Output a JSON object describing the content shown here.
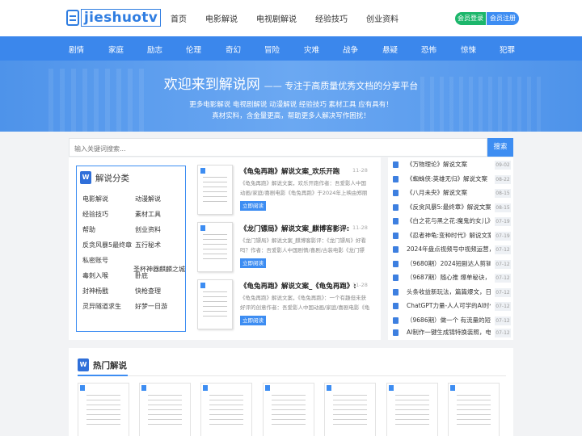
{
  "header": {
    "logo_text": "jieshuotv",
    "nav": [
      "首页",
      "电影解说",
      "电视剧解说",
      "经验技巧",
      "创业资料"
    ],
    "login_label": "会员登录",
    "register_label": "会员注册"
  },
  "categories": [
    "剧情",
    "家庭",
    "励志",
    "伦理",
    "奇幻",
    "冒险",
    "灾难",
    "战争",
    "悬疑",
    "恐怖",
    "惊悚",
    "犯罪"
  ],
  "banner": {
    "title_big": "欢迎来到解说网",
    "title_small": "—— 专注于高质量优秀文档的分享平台",
    "line1": "更多电影解说 电视剧解说 动漫解说 经验技巧 素材工具 应有具有！",
    "line2": "真材实料，含金量更高，帮助更多人解决写作困扰！"
  },
  "search": {
    "placeholder": "输入关键词搜索...",
    "button_label": "搜索"
  },
  "category_box": {
    "icon_letter": "W",
    "title": "解说分类",
    "items": [
      "电影解说",
      "动漫解说",
      "经验技巧",
      "素材工具",
      "帮助",
      "创业资料",
      "反贪风暴5最终章",
      "五行秘术",
      "私密账号",
      "圣杯神器麒麟之城",
      "毒刺入喉",
      "卧底",
      "封神杨戬",
      "快枪查理",
      "灵异隧道求生",
      "好梦一日游"
    ]
  },
  "cards": [
    {
      "title": "《龟兔再跑》解说文案_欢乐开跑",
      "date": "11-28",
      "desc": "《龟兔再跑》解说文案，欢乐开跑作者：吾爱影人中国动画/家庭/喜剧电影《龟兔再跑》于2024年上映由郑丽等",
      "button": "立即阅读"
    },
    {
      "title": "《龙门镖局》解说文案_麒博客影评:",
      "date": "11-28",
      "desc": "《龙门镖局》解说文案_麒博客影评：《龙门镖局》好看吗？作者：吾爱影人中国剧情/喜剧/古装电影《龙门镖",
      "button": "立即阅读"
    },
    {
      "title": "《龟兔再跑》解说文案_《龟兔再跑》:",
      "date": "11-28",
      "desc": "《龟兔再跑》解说文案，《龟兔再跑》：一个有趣但未获好评的创意作者：吾爱影人中国动画/家庭/喜剧电影《龟",
      "button": "立即阅读"
    }
  ],
  "latest_list": [
    {
      "title": "《万物理论》解说文案",
      "date": "09-02"
    },
    {
      "title": "《蜘蛛侠:英雄无归》解说文案",
      "date": "08-22"
    },
    {
      "title": "《八月未央》解说文案",
      "date": "08-15"
    },
    {
      "title": "《反贪风暴5:最终章》解说文案",
      "date": "08-15"
    },
    {
      "title": "《白之花与黑之花:魔鬼的女儿》",
      "date": "07-19"
    },
    {
      "title": "《忍者神龟:变种时代》解说文案",
      "date": "07-19"
    },
    {
      "title": "2024年盘点视频号中视频运营，",
      "date": "07-12"
    },
    {
      "title": "（9680期）2024短剧达人剪辑特",
      "date": "07-12"
    },
    {
      "title": "（9687期）随心推 爆单秘诀，短",
      "date": "07-12"
    },
    {
      "title": "头条收益新玩法，篇篇爆文，日",
      "date": "07-12"
    },
    {
      "title": "ChatGPT力量-人人可学的AI时代",
      "date": "07-12"
    },
    {
      "title": "（9686期）做一个 有流量的短视",
      "date": "07-12"
    },
    {
      "title": "AI制作一键生成锦特换装照，电",
      "date": "07-12"
    }
  ],
  "hot": {
    "icon_letter": "W",
    "title": "热门解说"
  },
  "colors": {
    "primary": "#3d8df2",
    "category_bar": "#3b87ec",
    "login_green": "#1cb66b",
    "background": "#f2f3f5"
  }
}
